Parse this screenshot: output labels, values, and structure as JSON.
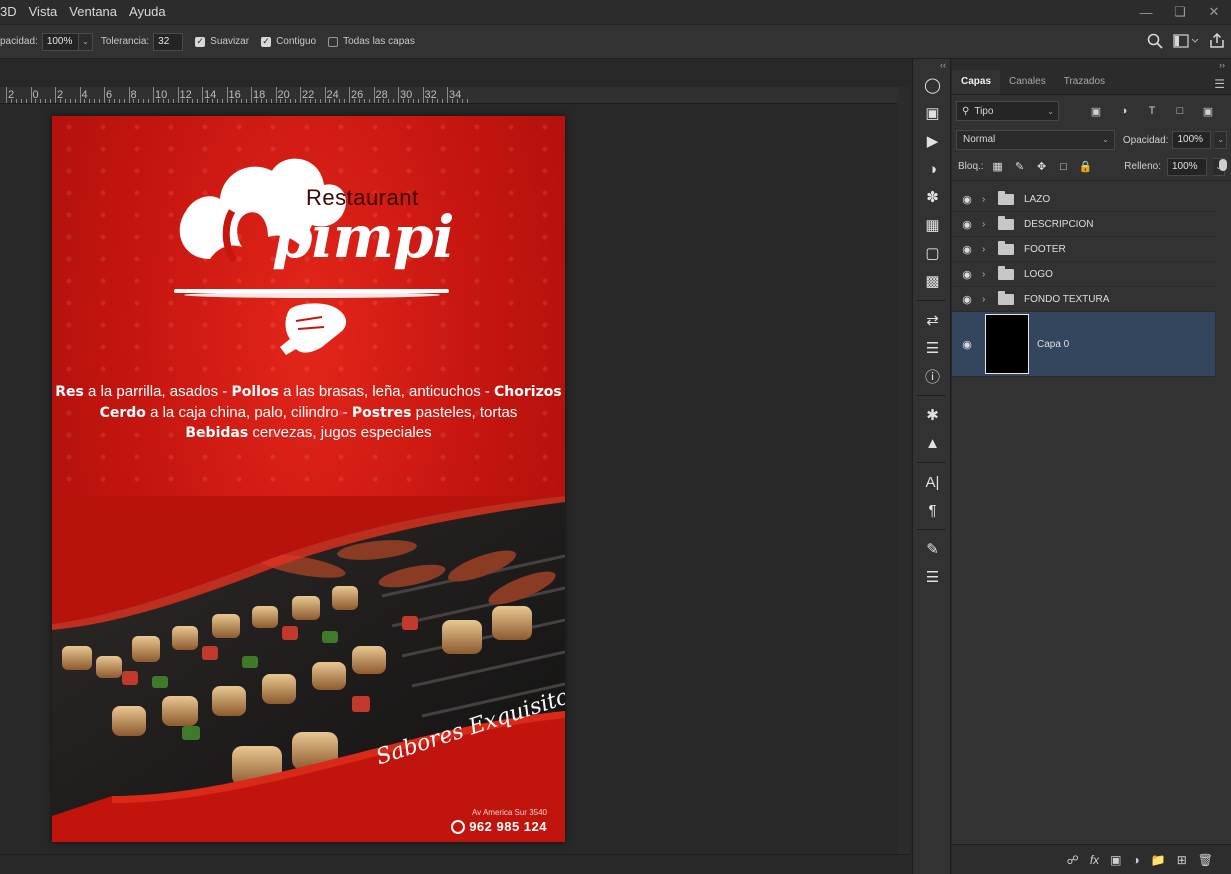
{
  "menu": [
    "3D",
    "Vista",
    "Ventana",
    "Ayuda"
  ],
  "window_controls": [
    "minimize-icon",
    "restore-icon",
    "close-icon"
  ],
  "options": {
    "opacity_label": "pacidad:",
    "opacity_value": "100%",
    "tolerance_label": "Tolerancia:",
    "tolerance_value": "32",
    "antialias_label": "Suavizar",
    "antialias_checked": true,
    "contiguous_label": "Contiguo",
    "contiguous_checked": true,
    "all_layers_label": "Todas las capas",
    "all_layers_checked": false
  },
  "ruler": {
    "labels": [
      "2",
      "0",
      "2",
      "4",
      "6",
      "8",
      "10",
      "12",
      "14",
      "16",
      "18",
      "20",
      "22",
      "24",
      "26",
      "28",
      "30",
      "32",
      "34"
    ]
  },
  "flyer": {
    "restaurant_label": "Restaurant",
    "brand_name": "pimpi",
    "desc_lines": [
      [
        {
          "b": "Res"
        },
        {
          "t": " a la parrilla, asados - "
        },
        {
          "b": "Pollos"
        },
        {
          "t": " a las brasas, leña, anticuchos - "
        },
        {
          "b": "Chorizos"
        }
      ],
      [
        {
          "b": "Cerdo"
        },
        {
          "t": " a la caja china, palo, cilindro - "
        },
        {
          "b": "Postres"
        },
        {
          "t": " pasteles, tortas"
        }
      ],
      [
        {
          "b": "Bebidas"
        },
        {
          "t": " cervezas, jugos especiales"
        }
      ]
    ],
    "slogan": "Sabores Exquisitos",
    "address": "Av America Sur 3540",
    "phone": "962 985 124",
    "colors": {
      "red": "#c8150e",
      "dark_red": "#a50d0a",
      "white": "#ffffff"
    }
  },
  "layers_panel": {
    "tabs": [
      "Capas",
      "Canales",
      "Trazados"
    ],
    "active_tab": "Capas",
    "filter_label": "Tipo",
    "blend_mode": "Normal",
    "opacity_label": "Opacidad:",
    "opacity_value": "100%",
    "lock_label": "Bloq.:",
    "fill_label": "Relleno:",
    "fill_value": "100%",
    "groups": [
      "LAZO",
      "DESCRIPCION",
      "FOOTER",
      "LOGO",
      "FONDO TEXTURA"
    ],
    "selected_layer": "Capa 0"
  },
  "colors": {
    "selection": "#33465e",
    "panel": "#323232",
    "app_bg": "#282828"
  }
}
